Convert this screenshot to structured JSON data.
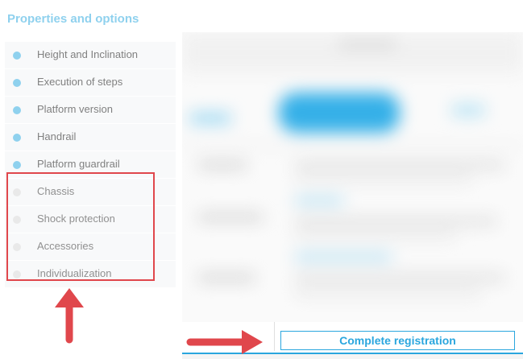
{
  "sidebar": {
    "title": "Properties and options",
    "steps": [
      {
        "label": "Height and Inclination",
        "done": true
      },
      {
        "label": "Execution of steps",
        "done": true
      },
      {
        "label": "Platform version",
        "done": true
      },
      {
        "label": "Handrail",
        "done": true
      },
      {
        "label": "Platform guardrail",
        "done": true
      },
      {
        "label": "Chassis",
        "done": false
      },
      {
        "label": "Shock protection",
        "done": false
      },
      {
        "label": "Accessories",
        "done": false
      },
      {
        "label": "Individualization",
        "done": false
      }
    ]
  },
  "footer": {
    "complete_label": "Complete registration"
  },
  "colors": {
    "accent": "#2aa6de",
    "step_done": "#8fd1ee",
    "step_pending": "#e9e9e9",
    "annotation": "#e0474c"
  }
}
